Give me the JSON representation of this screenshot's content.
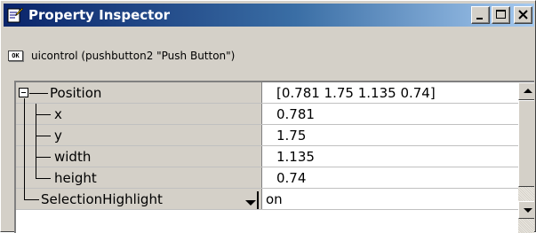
{
  "window": {
    "title": "Property Inspector",
    "title_icon": "property-inspector-icon",
    "buttons": [
      "minimize",
      "maximize",
      "close"
    ]
  },
  "object": {
    "badge": "OK",
    "description": "uicontrol (pushbutton2 \"Push Button\")"
  },
  "properties": [
    {
      "name": "Position",
      "value": "[0.781 1.75 1.135 0.74]",
      "expandable": true
    },
    {
      "name": "x",
      "value": "0.781"
    },
    {
      "name": "y",
      "value": "1.75"
    },
    {
      "name": "width",
      "value": "1.135"
    },
    {
      "name": "height",
      "value": "0.74"
    },
    {
      "name": "SelectionHighlight",
      "value": "on"
    }
  ],
  "colors": {
    "title_start": "#0a246a",
    "title_end": "#a6caf0",
    "chrome": "#d4d0c8"
  }
}
